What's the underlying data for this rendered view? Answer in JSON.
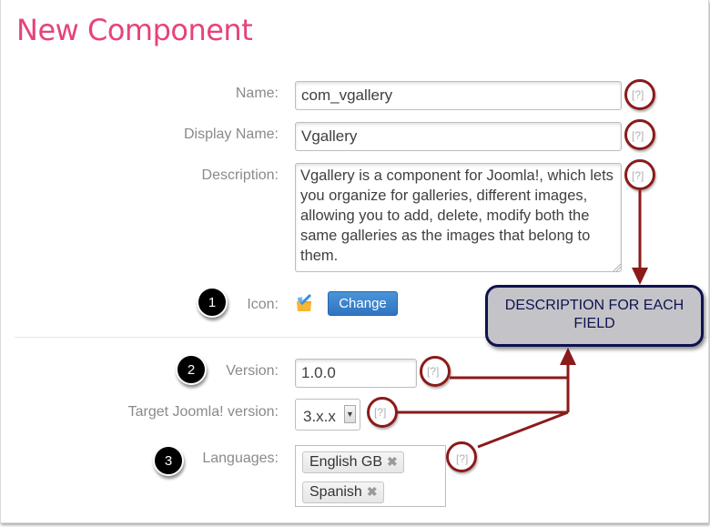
{
  "page": {
    "title": "New Component"
  },
  "form": {
    "name": {
      "label": "Name:",
      "value": "com_vgallery",
      "help": "[?]"
    },
    "display_name": {
      "label": "Display Name:",
      "value": "Vgallery",
      "help": "[?]"
    },
    "description": {
      "label": "Description:",
      "value": "Vgallery is a component for Joomla!, which lets you organize for galleries, different images, allowing you to add, delete, modify both the same galleries as the images that belong to them.",
      "help": "[?]"
    },
    "icon": {
      "label": "Icon:",
      "icon": "folder-check-icon",
      "change_label": "Change"
    },
    "version": {
      "label": "Version:",
      "value": "1.0.0",
      "help": "[?]"
    },
    "target_joomla": {
      "label": "Target Joomla! version:",
      "selected": "3.x.x",
      "help": "[?]"
    },
    "languages": {
      "label": "Languages:",
      "tags": [
        "English GB",
        "Spanish"
      ],
      "remove_glyph": "✖",
      "help": "[?]"
    }
  },
  "annotations": {
    "badges": [
      "1",
      "2",
      "3"
    ],
    "callout": "DESCRIPTION FOR EACH FIELD",
    "accent_color": "#8b1a1a",
    "callout_border": "#0e1250"
  }
}
